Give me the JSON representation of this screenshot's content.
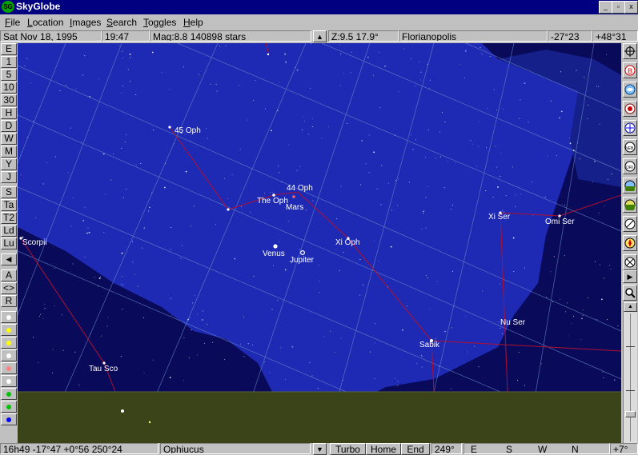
{
  "app": {
    "title": "SkyGlobe",
    "icon_label": "SG"
  },
  "window_controls": {
    "minimize": "_",
    "maximize": "▫",
    "close": "x"
  },
  "menu": [
    "File",
    "Location",
    "Images",
    "Search",
    "Toggles",
    "Help"
  ],
  "top_status": {
    "date": "Sat  Nov 18, 1995",
    "time": "19:47",
    "mag": "Mag:8.8  140898 stars",
    "zoom": "Z:9.5  17.9°",
    "location": "Florianopolis",
    "latitude": "-27°23",
    "longitude": "+48°31"
  },
  "left_toolbar": [
    "E",
    "1",
    "5",
    "10",
    "30",
    "H",
    "D",
    "W",
    "M",
    "Y",
    "J",
    "S",
    "Ta",
    "T2",
    "Ld",
    "Lu",
    "◀",
    "A",
    "<>",
    "R"
  ],
  "color_dots": [
    "#ffffff",
    "#ffff00",
    "#ffff00",
    "#ffffff",
    "#ff8080",
    "#ffffff",
    "#00c000",
    "#00c000",
    "#0000ff"
  ],
  "right_toolbar_icons": [
    "crosshair-icon",
    "constellation-b-icon",
    "galaxy-icon",
    "eye-icon",
    "cross-star-icon",
    "neb-icon",
    "orbit-icon",
    "horizon-icon",
    "meteor-icon",
    "compass-icon",
    "scope-icon",
    "magnifier-icon"
  ],
  "sky_labels": {
    "45oph": "45 Oph",
    "44oph": "44 Oph",
    "theoph": "The Oph",
    "mars": "Mars",
    "venus": "Venus",
    "jupiter": "Jupiter",
    "xioph": "Xi Oph",
    "scorpii": "Scorpii",
    "xiser": "Xi Ser",
    "omiser": "Omi Ser",
    "nuser": "Nu Ser",
    "sabik": "Sabik",
    "tausco": "Tau Sco"
  },
  "colors": {
    "sky_bg": "#0a0a5a",
    "milky_way": "#1e2ab4",
    "horizon": "#3a4418",
    "constellation": "#b01030",
    "grid": "#6a8cc8"
  },
  "bottom_status": {
    "coords": "16h49 -17°47  +0°56 250°24",
    "constellation": "Ophiucus",
    "turbo": "Turbo",
    "home": "Home",
    "end": "End",
    "azimuth": "249°",
    "compass": [
      "E",
      "S",
      "W",
      "N"
    ],
    "altitude": "+7°"
  }
}
